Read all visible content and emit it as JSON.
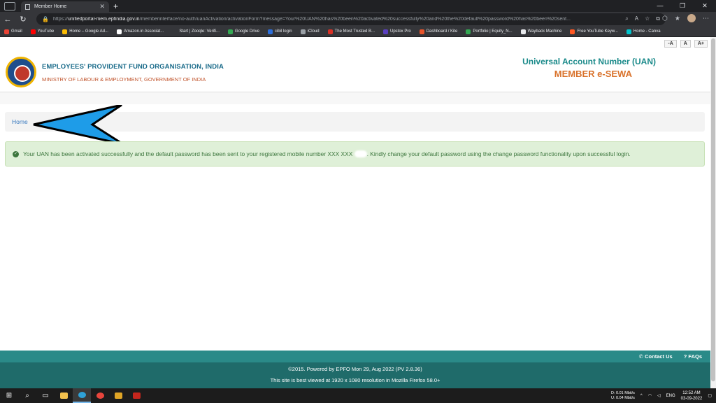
{
  "browser": {
    "tab_title": "Member Home",
    "tab_close": "✕",
    "new_tab": "+",
    "url_host": "unifiedportal-mem.epfindia.gov.in",
    "url_path": "/memberinterface/no-auth/uanActivation/activationForm?message=Your%20UAN%20has%20been%20activated%20successfully%20and%20the%20default%20password%20has%20been%20sent...",
    "url_prefix": "https://",
    "bookmarks": [
      {
        "label": "Gmail",
        "color": "#ea4335"
      },
      {
        "label": "YouTube",
        "color": "#ff0000"
      },
      {
        "label": "Home – Google Ad...",
        "color": "#fbbc04"
      },
      {
        "label": "Amazon.in Associat...",
        "color": "#ffffff"
      },
      {
        "label": "Start | Zooqle: Verifi...",
        "color": "#35363a"
      },
      {
        "label": "Google Drive",
        "color": "#34a853"
      },
      {
        "label": "cibil login",
        "color": "#2d6fdb"
      },
      {
        "label": "iCloud",
        "color": "#9aa0a6"
      },
      {
        "label": "The Most Trusted B...",
        "color": "#d93025"
      },
      {
        "label": "Upstox Pro",
        "color": "#5a3fc0"
      },
      {
        "label": "Dashboard / Kite",
        "color": "#e8542b"
      },
      {
        "label": "Portfolio | Equity_N...",
        "color": "#34a853"
      },
      {
        "label": "Wayback Machine",
        "color": "#e8eaed"
      },
      {
        "label": "Free YouTube Keyw...",
        "color": "#ff5722"
      },
      {
        "label": "Home - Canva",
        "color": "#00c4cc"
      }
    ]
  },
  "page": {
    "font_controls": [
      "-A",
      "A",
      "A+"
    ],
    "org_name": "EMPLOYEES' PROVIDENT FUND ORGANISATION, INDIA",
    "org_sub": "MINISTRY OF LABOUR & EMPLOYMENT, GOVERNMENT OF INDIA",
    "uan_title": "Universal Account Number (UAN)",
    "sewa_title": "MEMBER e-SEWA",
    "breadcrumb_home": "Home",
    "alert_pre": "Your UAN has been activated successfully and the default password has been sent to your registered mobile number XXX XXX",
    "alert_post": ". Kindly change your default password using the change password functionality upon successful login.",
    "contact_us": "Contact Us",
    "faqs": "FAQs",
    "footer_line1": "©2015. Powered by EPFO Mon 29, Aug 2022 (PV 2.8.36)",
    "footer_line2": "This site is best viewed at 1920 x 1080 resolution in Mozilla Firefox 58.0+"
  },
  "taskbar": {
    "net_down": "D:",
    "net_down_val": "0.01 Mbit/s",
    "net_up": "U:",
    "net_up_val": "0.04 Mbit/s",
    "lang": "ENG",
    "time": "12:52 AM",
    "date": "03-09-2022"
  },
  "colors": {
    "accent_teal": "#2a8a88",
    "orange": "#d9722b",
    "success_bg": "#dff0d8",
    "annotation_arrow": "#1e9ce8"
  }
}
